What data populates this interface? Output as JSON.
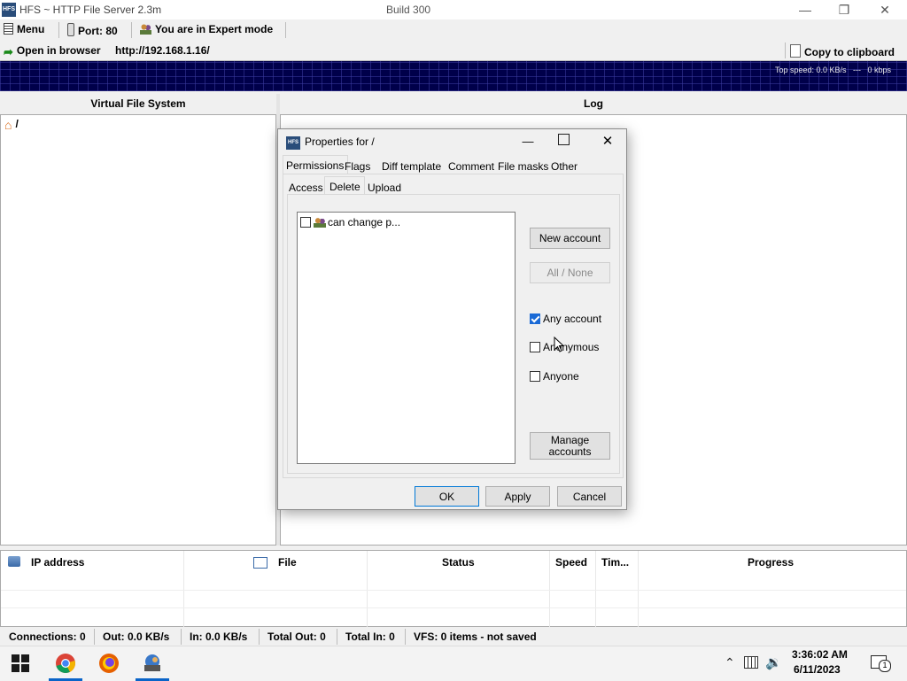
{
  "window": {
    "title": "HFS ~ HTTP File Server 2.3m",
    "build": "Build 300",
    "logo_text": "HFS"
  },
  "toolbar": {
    "menu": "Menu",
    "port": "Port: 80",
    "mode": "You are in Expert mode",
    "open_browser": "Open in browser",
    "url": "http://192.168.1.16/",
    "copy_clipboard": "Copy to clipboard"
  },
  "graph": {
    "top_speed": "Top speed: 0.0 KB/s   ---   0 kbps"
  },
  "panes": {
    "vfs_title": "Virtual File System",
    "log_title": "Log",
    "root_label": "/"
  },
  "connections": {
    "columns": [
      "IP address",
      "File",
      "Status",
      "Speed",
      "Tim...",
      "Progress"
    ]
  },
  "statusbar": {
    "connections": "Connections: 0",
    "out": "Out: 0.0 KB/s",
    "in": "In: 0.0 KB/s",
    "total_out": "Total Out: 0",
    "total_in": "Total In: 0",
    "vfs": "VFS: 0 items - not saved"
  },
  "dialog": {
    "title": "Properties for /",
    "logo_text": "HFS",
    "tabs": [
      "Permissions",
      "Flags",
      "Diff template",
      "Comment",
      "File masks",
      "Other"
    ],
    "subtabs": [
      "Access",
      "Delete",
      "Upload"
    ],
    "account_item": "can change p...",
    "new_account": "New account",
    "all_none": "All / None",
    "any_account": "Any account",
    "anonymous": "Anonymous",
    "anyone": "Anyone",
    "manage_accounts_1": "Manage",
    "manage_accounts_2": "accounts",
    "ok": "OK",
    "apply": "Apply",
    "cancel": "Cancel"
  },
  "taskbar": {
    "time": "3:36:02 AM",
    "date": "6/11/2023",
    "notification_count": "1"
  },
  "colors": {
    "graph_bg": "#00004a",
    "accent": "#0a64c8",
    "checkbox_checked": "#1a6ad6"
  }
}
